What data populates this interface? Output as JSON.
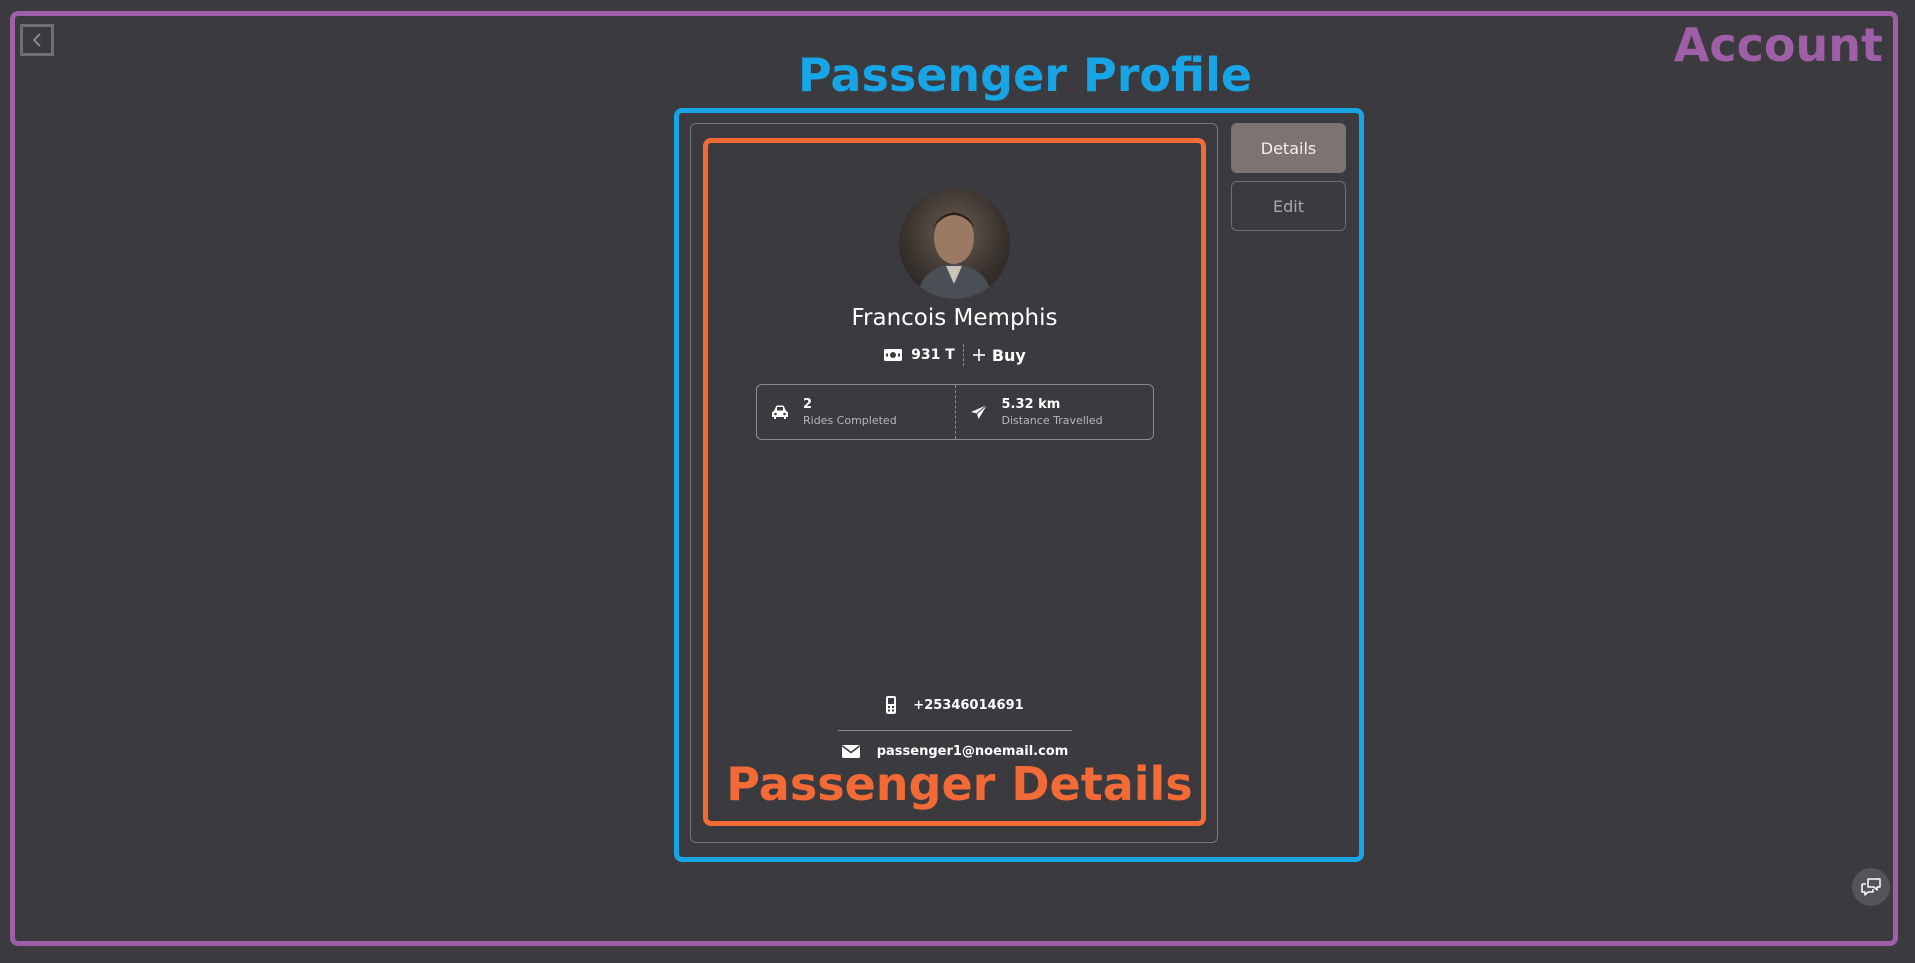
{
  "annotations": {
    "account": "Account",
    "passenger_profile": "Passenger Profile",
    "passenger_details": "Passenger Details"
  },
  "tabs": {
    "details": "Details",
    "edit": "Edit"
  },
  "profile": {
    "name": "Francois Memphis",
    "balance": "931 T",
    "buy_label": "Buy",
    "rides_completed_value": "2",
    "rides_completed_label": "Rides Completed",
    "distance_value": "5.32 km",
    "distance_label": "Distance Travelled",
    "phone": "+25346014691",
    "email": "passenger1@noemail.com"
  },
  "icons": {
    "back": "chevron-left-icon",
    "money": "money-icon",
    "plus": "plus-icon",
    "car": "car-icon",
    "send": "paper-plane-icon",
    "phone": "phone-icon",
    "email": "envelope-icon",
    "chat": "chat-icon"
  },
  "colors": {
    "background": "#3b3a3f",
    "account_annotation": "#9f5fa6",
    "profile_annotation": "#18a5e6",
    "details_annotation": "#f26b36",
    "active_tab": "#7b7470"
  }
}
